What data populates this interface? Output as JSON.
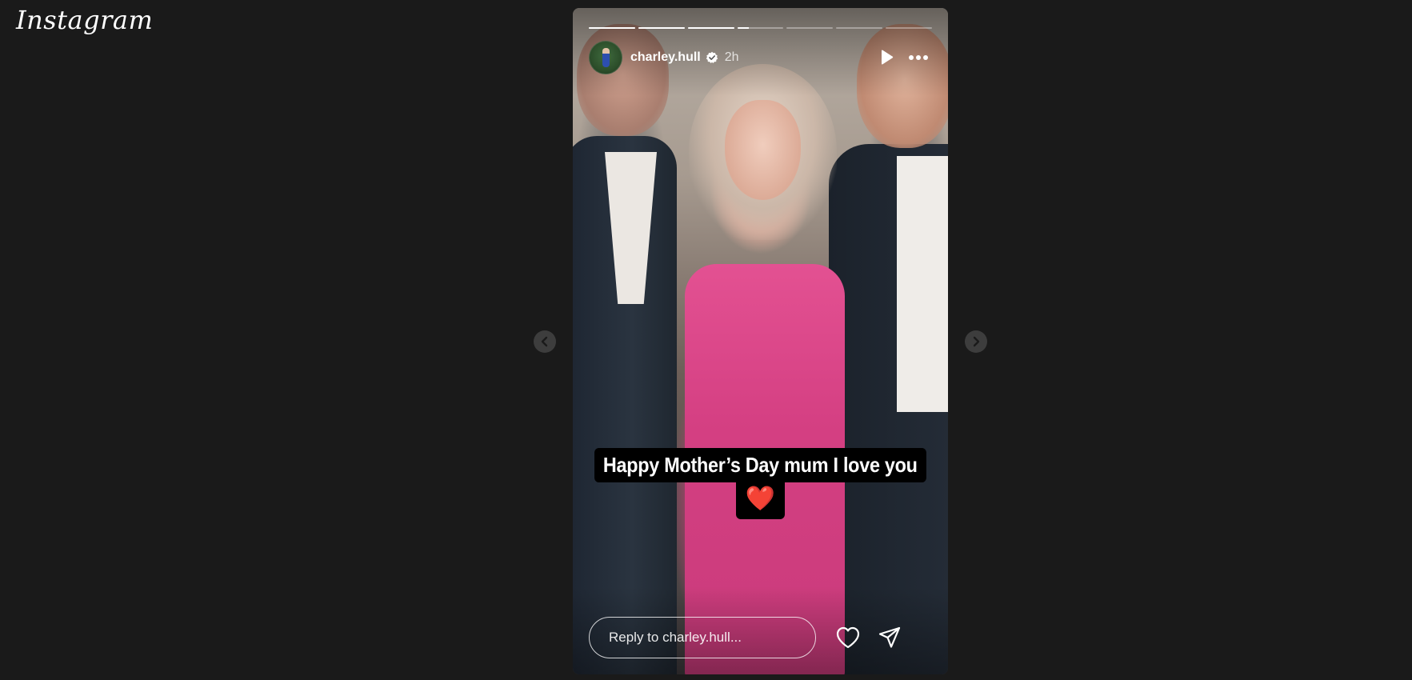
{
  "app": {
    "logo_text": "Instagram"
  },
  "story": {
    "progress": [
      1,
      1,
      1,
      0.25,
      0,
      0,
      0
    ],
    "user": {
      "username": "charley.hull",
      "verified": true,
      "time": "2h"
    },
    "caption": {
      "text": "Happy Mother’s Day mum I love you",
      "emoji": "❤️"
    },
    "reply": {
      "placeholder": "Reply to charley.hull..."
    }
  },
  "icons": {
    "play": "play-icon",
    "more": "more-options-icon",
    "like": "heart-icon",
    "share": "send-icon",
    "prev": "chevron-left-icon",
    "next": "chevron-right-icon",
    "verified": "verified-badge-icon"
  },
  "colors": {
    "background": "#1a1a1a",
    "nav_button": "#3d3d3d",
    "caption_bg": "#000000"
  }
}
